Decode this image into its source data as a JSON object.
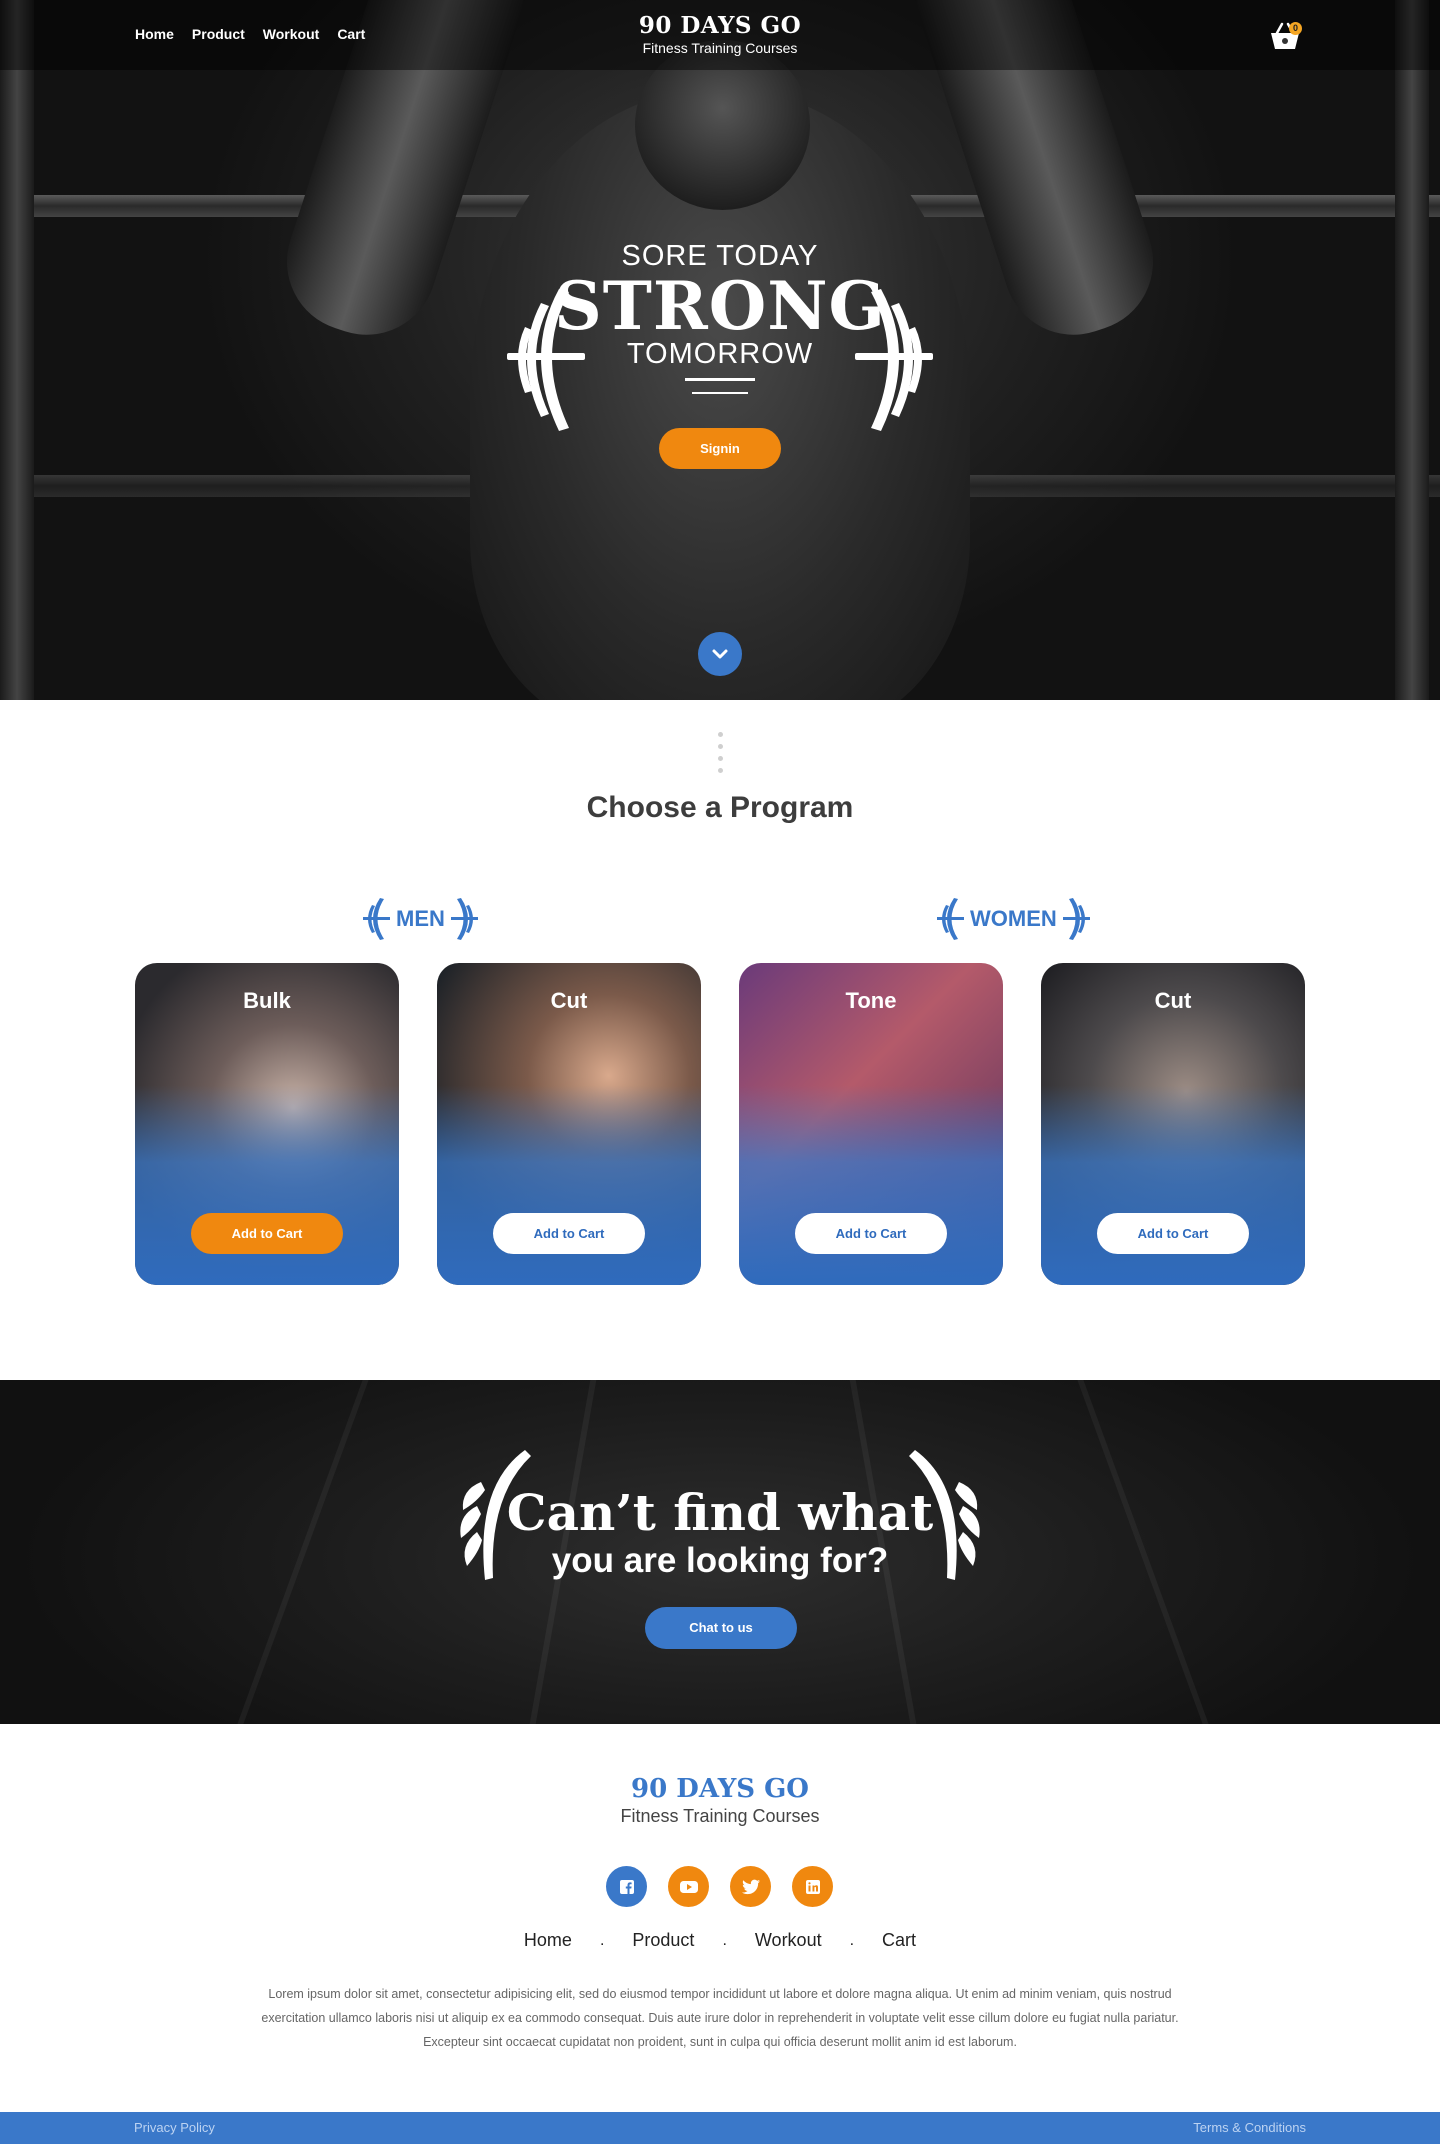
{
  "header": {
    "nav": [
      "Home",
      "Product",
      "Workout",
      "Cart"
    ],
    "brand_title": "90 DAYS GO",
    "brand_subtitle": "Fitness Training Courses",
    "cart_count": "0"
  },
  "hero": {
    "line1": "SORE TODAY",
    "line2": "STRONG",
    "line3": "TOMORROW",
    "signin_label": "Signin"
  },
  "programs": {
    "title": "Choose a Program",
    "groups": [
      "MEN",
      "WOMEN"
    ],
    "cards": [
      {
        "title": "Bulk",
        "button": "Add to Cart"
      },
      {
        "title": "Cut",
        "button": "Add to Cart"
      },
      {
        "title": "Tone",
        "button": "Add to Cart"
      },
      {
        "title": "Cut",
        "button": "Add to Cart"
      }
    ]
  },
  "cta": {
    "line1": "Can’t find what",
    "line2": "you are looking for?",
    "button": "Chat to us"
  },
  "footer": {
    "brand_title": "90 DAYS GO",
    "brand_subtitle": "Fitness Training Courses",
    "nav": [
      "Home",
      "Product",
      "Workout",
      "Cart"
    ],
    "separator": ".",
    "lorem": "Lorem ipsum dolor sit amet, consectetur adipisicing elit, sed do eiusmod tempor incididunt ut labore et dolore magna aliqua. Ut enim ad minim veniam, quis nostrud exercitation ullamco laboris nisi ut aliquip ex ea commodo consequat. Duis aute irure dolor in reprehenderit in voluptate velit esse cillum dolore eu fugiat nulla pariatur. Excepteur sint occaecat cupidatat non proident, sunt in culpa qui officia deserunt mollit anim id est laborum.",
    "privacy": "Privacy Policy",
    "terms": "Terms & Conditions"
  },
  "colors": {
    "accent_orange": "#f0880f",
    "accent_blue": "#3a78c9",
    "badge_yellow": "#f5a623"
  },
  "icons": [
    "cart-icon",
    "chevron-down-icon",
    "facebook-icon",
    "youtube-icon",
    "twitter-icon",
    "linkedin-icon",
    "dumbbell-icon",
    "laurel-wing-icon"
  ]
}
